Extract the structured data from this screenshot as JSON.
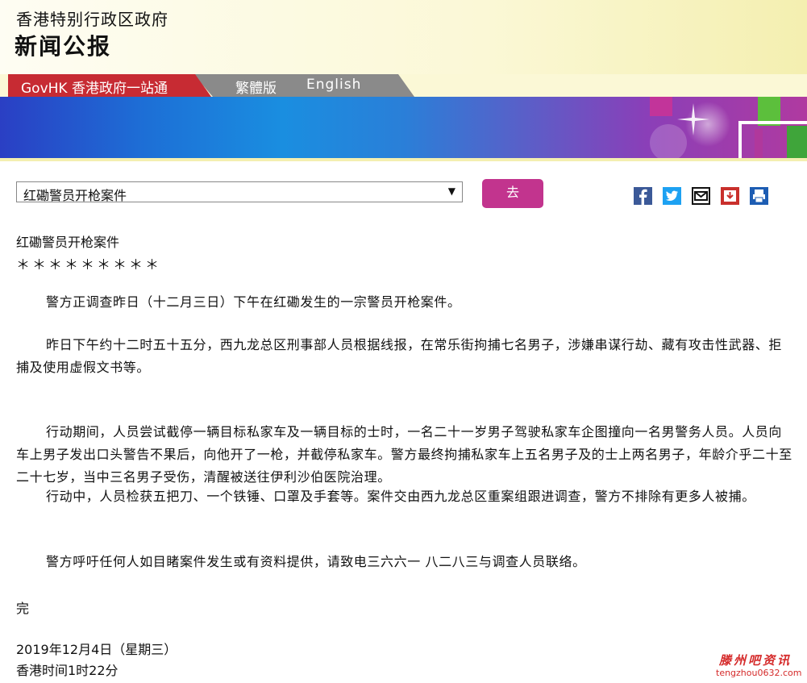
{
  "header": {
    "org": "香港特别行政区政府",
    "title": "新闻公报"
  },
  "nav": {
    "govhk": "GovHK 香港政府一站通",
    "traditional": "繁體版",
    "english": "English"
  },
  "topic_select": {
    "selected": "红磡警员开枪案件"
  },
  "go_button": "去",
  "share_icons": [
    "facebook-icon",
    "twitter-icon",
    "mail-icon",
    "pdf-icon",
    "print-icon"
  ],
  "article": {
    "title": "红磡警员开枪案件",
    "separator": "＊＊＊＊＊＊＊＊＊",
    "paragraphs": [
      "警方正调查昨日（十二月三日）下午在红磡发生的一宗警员开枪案件。",
      "昨日下午约十二时五十五分，西九龙总区刑事部人员根据线报，在常乐街拘捕七名男子，涉嫌串谋行劫、藏有攻击性武器、拒捕及使用虚假文书等。",
      "行动期间，人员尝试截停一辆目标私家车及一辆目标的士时，一名二十一岁男子驾驶私家车企图撞向一名男警务人员。人员向车上男子发出口头警告不果后，向他开了一枪，并截停私家车。警方最终拘捕私家车上五名男子及的士上两名男子，年龄介乎二十至二十七岁，当中三名男子受伤，清醒被送往伊利沙伯医院治理。",
      "行动中，人员检获五把刀、一个铁锤、口罩及手套等。案件交由西九龙总区重案组跟进调查，警方不排除有更多人被捕。",
      "警方呼吁任何人如目睹案件发生或有资料提供，请致电三六六一 八二八三与调查人员联络。"
    ],
    "end": "完",
    "date": "2019年12月4日（星期三）",
    "time": "香港时间1时22分"
  },
  "watermark": {
    "name": "滕州吧资讯",
    "url": "tengzhou0632.com"
  },
  "colors": {
    "govhk_red": "#c72b33",
    "go_button": "#c2348e",
    "watermark": "#d52a2a"
  }
}
